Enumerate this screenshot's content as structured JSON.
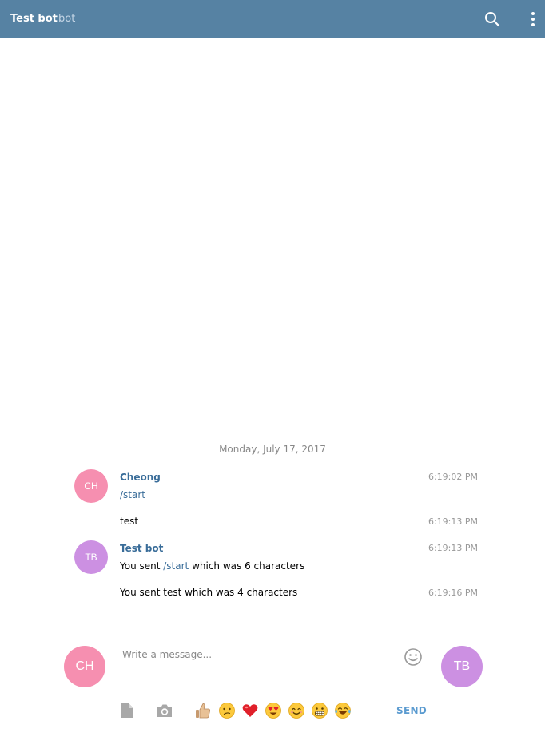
{
  "header": {
    "title": "Test bot",
    "subtitle": "bot"
  },
  "chat": {
    "date_divider": "Monday, July 17, 2017",
    "groups": [
      {
        "author": "Cheong",
        "initials": "CH",
        "messages": [
          {
            "parts": [
              "",
              "/start",
              ""
            ],
            "time": "6:19:02 PM"
          },
          {
            "text": "test",
            "time": "6:19:13 PM"
          }
        ]
      },
      {
        "author": "Test bot",
        "initials": "TB",
        "messages": [
          {
            "parts": [
              "You sent ",
              "/start",
              " which was 6 characters"
            ],
            "time": "6:19:13 PM"
          },
          {
            "text": "You sent test which was 4 characters",
            "time": "6:19:16 PM"
          }
        ]
      }
    ]
  },
  "composer": {
    "placeholder": "Write a message...",
    "self_initials": "CH",
    "peer_initials": "TB",
    "send_label": "SEND",
    "quick_emojis": [
      "thumbs-up",
      "confused-face",
      "red-heart",
      "heart-eyes-face",
      "smiling-face",
      "grimacing-face",
      "tears-of-joy-face"
    ]
  },
  "colors": {
    "header_bg": "#5682a3",
    "link": "#3a6d99",
    "avatar_ch": "#f68fb0",
    "avatar_tb": "#cc90e2",
    "send": "#5b9bd0"
  }
}
